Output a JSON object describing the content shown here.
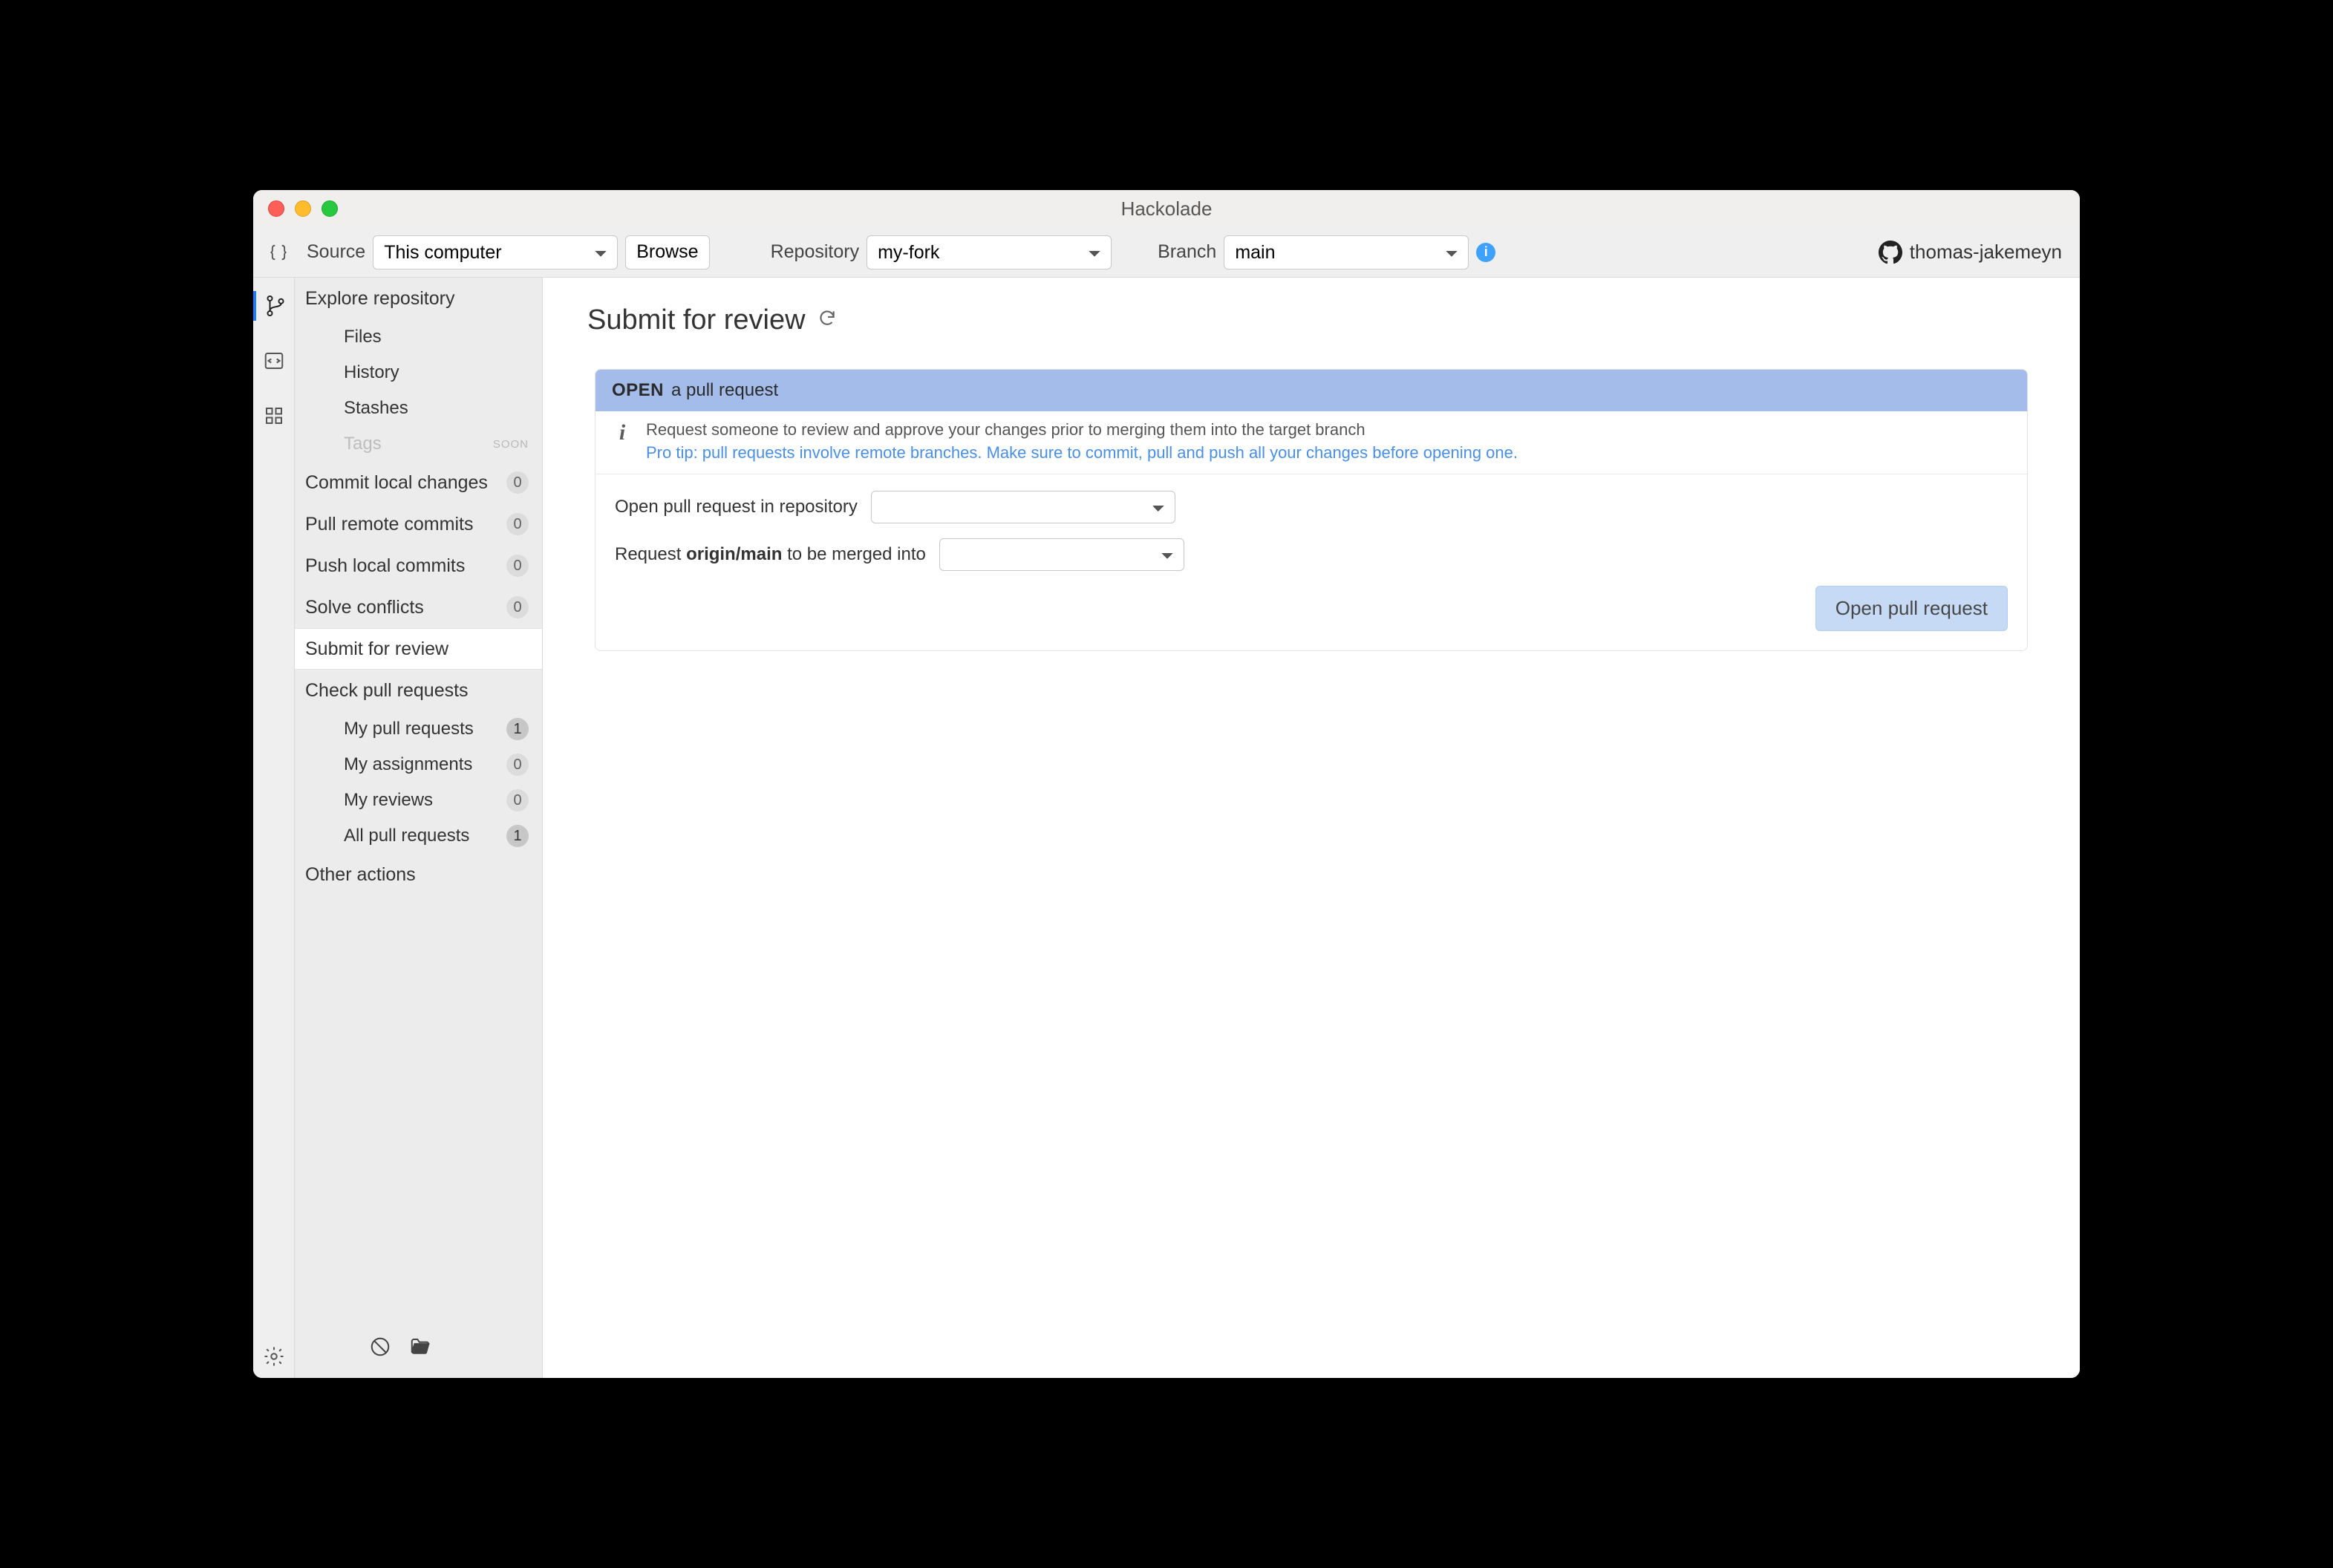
{
  "window": {
    "title": "Hackolade"
  },
  "toolbar": {
    "source_label": "Source",
    "source_value": "This computer",
    "browse_label": "Browse",
    "repository_label": "Repository",
    "repository_value": "my-fork",
    "branch_label": "Branch",
    "branch_value": "main",
    "username": "thomas-jakemeyn"
  },
  "sidebar": {
    "explore_label": "Explore repository",
    "explore_items": {
      "files": "Files",
      "history": "History",
      "stashes": "Stashes",
      "tags": "Tags",
      "tags_soon": "SOON"
    },
    "commit_label": "Commit local changes",
    "commit_count": "0",
    "pull_label": "Pull remote commits",
    "pull_count": "0",
    "push_label": "Push local commits",
    "push_count": "0",
    "solve_label": "Solve conflicts",
    "solve_count": "0",
    "submit_label": "Submit for review",
    "check_label": "Check pull requests",
    "check_items": {
      "my_pr": "My pull requests",
      "my_pr_count": "1",
      "my_assign": "My assignments",
      "my_assign_count": "0",
      "my_reviews": "My reviews",
      "my_reviews_count": "0",
      "all_pr": "All pull requests",
      "all_pr_count": "1"
    },
    "other_label": "Other actions"
  },
  "main": {
    "page_title": "Submit for review",
    "panel_open": "OPEN",
    "panel_open_sub": "a pull request",
    "info_line1": "Request someone to review and approve your changes prior to merging them into the target branch",
    "info_tip": "Pro tip: pull requests involve remote branches. Make sure to commit, pull and push all your changes before opening one.",
    "form_repo_label": "Open pull request in repository",
    "form_repo_value": "",
    "form_merge_prefix": "Request ",
    "form_merge_branch": "origin/main",
    "form_merge_suffix": " to be merged into",
    "form_merge_value": "",
    "submit_button": "Open pull request"
  }
}
